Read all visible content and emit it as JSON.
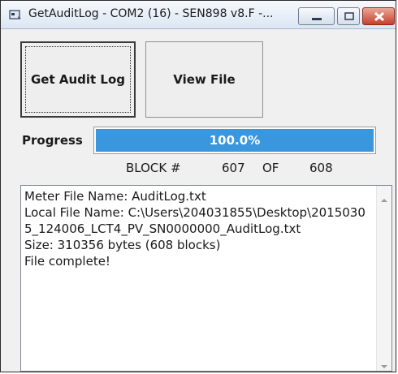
{
  "window": {
    "title": "GetAuditLog - COM2 (16) - SEN898 v8.F -..."
  },
  "buttons": {
    "get_audit_log": "Get Audit Log",
    "view_file": "View File"
  },
  "progress": {
    "label": "Progress",
    "percent_text": "100.0%",
    "fraction": 1.0
  },
  "block": {
    "label": "BLOCK #",
    "current": "607",
    "of_label": "OF",
    "total": "608"
  },
  "log": {
    "lines": [
      "Meter File Name: AuditLog.txt",
      "Local File Name: C:\\Users\\204031855\\Desktop\\20150305_124006_LCT4_PV_SN0000000_AuditLog.txt",
      "Size: 310356 bytes (608 blocks)",
      "File complete!"
    ]
  },
  "colors": {
    "progress_fill": "#3a96dd",
    "close_button": "#c6402c"
  },
  "icons": [
    "app-icon",
    "minimize-icon",
    "maximize-icon",
    "close-icon",
    "scroll-up-arrow-icon",
    "scroll-down-arrow-icon"
  ]
}
